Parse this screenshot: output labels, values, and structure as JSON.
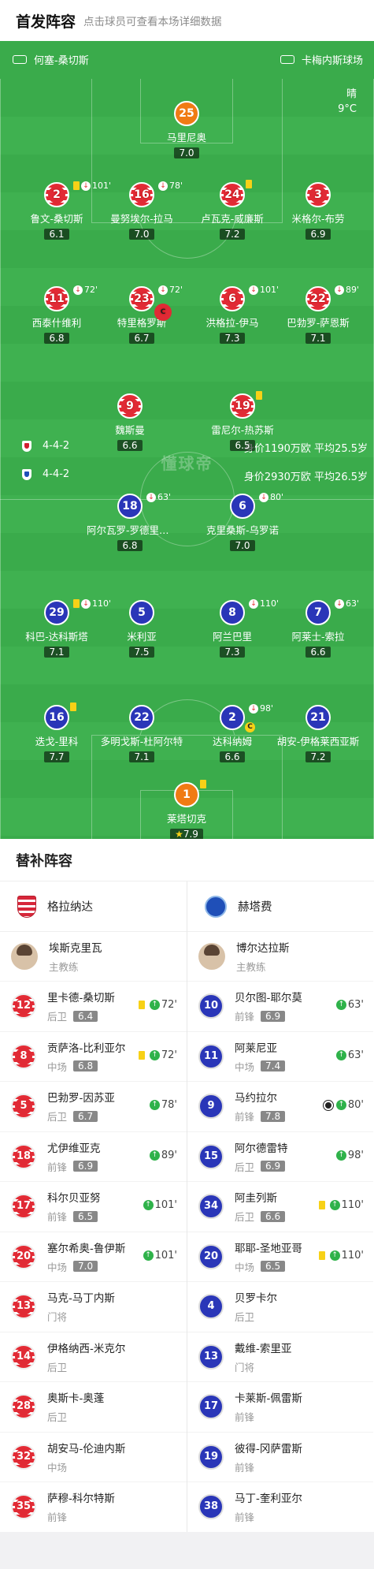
{
  "header": {
    "title": "首发阵容",
    "subtitle": "点击球员可查看本场详细数据"
  },
  "pitch": {
    "home_coach_label": "何塞-桑切斯",
    "venue": "卡梅内斯球场",
    "weather": "晴",
    "temp": "9°C",
    "watermark": "懂球帝",
    "home_formation": "4-4-2",
    "home_value": "身价1190万欧 平均25.5岁",
    "away_formation": "4-4-2",
    "away_value": "身价2930万欧 平均26.5岁"
  },
  "home_players": [
    {
      "num": "25",
      "name": "马里尼奥",
      "rating": "7.0",
      "kit": "orange"
    },
    {
      "num": "2",
      "name": "鲁文-桑切斯",
      "rating": "6.1",
      "kit": "red",
      "yellow": true,
      "sub": "101'"
    },
    {
      "num": "16",
      "name": "曼努埃尔-拉马",
      "rating": "7.0",
      "kit": "red",
      "sub": "78'"
    },
    {
      "num": "24",
      "name": "卢瓦克-威廉斯",
      "rating": "7.2",
      "kit": "red",
      "yellow": true
    },
    {
      "num": "3",
      "name": "米格尔-布劳",
      "rating": "6.9",
      "kit": "red"
    },
    {
      "num": "11",
      "name": "西泰什维利",
      "rating": "6.8",
      "kit": "red",
      "sub": "72'"
    },
    {
      "num": "23",
      "name": "特里格罗斯",
      "rating": "6.7",
      "kit": "red",
      "sub": "72'",
      "captain": "C"
    },
    {
      "num": "6",
      "name": "洪格拉-伊马",
      "rating": "7.3",
      "kit": "red",
      "sub": "101'"
    },
    {
      "num": "22",
      "name": "巴勃罗-萨恩斯",
      "rating": "7.1",
      "kit": "red",
      "sub": "89'"
    },
    {
      "num": "9",
      "name": "魏斯曼",
      "rating": "6.6",
      "kit": "red"
    },
    {
      "num": "19",
      "name": "雷尼尔-热苏斯",
      "rating": "6.5",
      "kit": "red",
      "yellow": true
    }
  ],
  "away_players": [
    {
      "num": "18",
      "name": "阿尔瓦罗-罗德里格斯",
      "rating": "6.8",
      "kit": "blue",
      "sub": "63'"
    },
    {
      "num": "6",
      "name": "克里桑斯-乌罗诺",
      "rating": "7.0",
      "kit": "blue",
      "sub": "80'"
    },
    {
      "num": "29",
      "name": "科巴-达科斯塔",
      "rating": "7.1",
      "kit": "blue",
      "yellow": true,
      "sub": "110'"
    },
    {
      "num": "5",
      "name": "米利亚",
      "rating": "7.5",
      "kit": "blue"
    },
    {
      "num": "8",
      "name": "阿兰巴里",
      "rating": "7.3",
      "kit": "blue",
      "sub": "110'"
    },
    {
      "num": "7",
      "name": "阿莱士-索拉",
      "rating": "6.6",
      "kit": "blue",
      "sub": "63'"
    },
    {
      "num": "16",
      "name": "迭戈-里科",
      "rating": "7.7",
      "kit": "blue",
      "yellow": true
    },
    {
      "num": "22",
      "name": "多明戈斯-杜阿尔特",
      "rating": "7.1",
      "kit": "blue"
    },
    {
      "num": "2",
      "name": "达科纳姆",
      "rating": "6.6",
      "kit": "blue",
      "sub": "98'",
      "captain": "C"
    },
    {
      "num": "21",
      "name": "胡安-伊格莱西亚斯",
      "rating": "7.2",
      "kit": "blue"
    },
    {
      "num": "1",
      "name": "莱塔切克",
      "rating": "7.9",
      "kit": "orange",
      "yellow": true,
      "star": true
    }
  ],
  "bench": {
    "title": "替补阵容",
    "home_team": "格拉纳达",
    "away_team": "赫塔费",
    "home_coach": {
      "name": "埃斯克里瓦",
      "role": "主教练"
    },
    "away_coach": {
      "name": "博尔达拉斯",
      "role": "主教练"
    },
    "home_subs": [
      {
        "num": "12",
        "name": "里卡德-桑切斯",
        "pos": "后卫",
        "rating": "6.4",
        "yellow": true,
        "in": "72'"
      },
      {
        "num": "8",
        "name": "贡萨洛-比利亚尔",
        "pos": "中场",
        "rating": "6.8",
        "yellow": true,
        "in": "72'"
      },
      {
        "num": "5",
        "name": "巴勃罗-因苏亚",
        "pos": "后卫",
        "rating": "6.7",
        "in": "78'"
      },
      {
        "num": "18",
        "name": "尤伊维亚克",
        "pos": "前锋",
        "rating": "6.9",
        "in": "89'"
      },
      {
        "num": "17",
        "name": "科尔贝亚努",
        "pos": "前锋",
        "rating": "6.5",
        "in": "101'"
      },
      {
        "num": "20",
        "name": "塞尔希奥-鲁伊斯",
        "pos": "中场",
        "rating": "7.0",
        "in": "101'"
      },
      {
        "num": "13",
        "name": "马克-马丁内斯",
        "pos": "门将"
      },
      {
        "num": "14",
        "name": "伊格纳西-米克尔",
        "pos": "后卫"
      },
      {
        "num": "28",
        "name": "奥斯卡-奥蓬",
        "pos": "后卫"
      },
      {
        "num": "32",
        "name": "胡安马-伦迪内斯",
        "pos": "中场"
      },
      {
        "num": "35",
        "name": "萨穆-科尔特斯",
        "pos": "前锋"
      }
    ],
    "away_subs": [
      {
        "num": "10",
        "name": "贝尔图-耶尔莫",
        "pos": "前锋",
        "rating": "6.9",
        "in": "63'"
      },
      {
        "num": "11",
        "name": "阿莱尼亚",
        "pos": "中场",
        "rating": "7.4",
        "in": "63'"
      },
      {
        "num": "9",
        "name": "马约拉尔",
        "pos": "前锋",
        "rating": "7.8",
        "goal": true,
        "in": "80'"
      },
      {
        "num": "15",
        "name": "阿尔德雷特",
        "pos": "后卫",
        "rating": "6.9",
        "in": "98'"
      },
      {
        "num": "34",
        "name": "阿圭列斯",
        "pos": "后卫",
        "rating": "6.6",
        "yellow": true,
        "in": "110'"
      },
      {
        "num": "20",
        "name": "耶耶-圣地亚哥",
        "pos": "中场",
        "rating": "6.5",
        "yellow": true,
        "in": "110'"
      },
      {
        "num": "4",
        "name": "贝罗卡尔",
        "pos": "后卫"
      },
      {
        "num": "13",
        "name": "戴维-索里亚",
        "pos": "门将"
      },
      {
        "num": "17",
        "name": "卡莱斯-佩雷斯",
        "pos": "前锋"
      },
      {
        "num": "19",
        "name": "彼得-冈萨雷斯",
        "pos": "前锋"
      },
      {
        "num": "38",
        "name": "马丁-奎利亚尔",
        "pos": "前锋"
      }
    ]
  },
  "colors": {
    "pitch": "#3fb150",
    "home_kit": "#e42b35",
    "away_kit": "#2a36b8",
    "keeper": "#f07b14",
    "yellow_card": "#f7d117",
    "sub_in": "#2fb24a"
  },
  "icons": {
    "whistle": "whistle-icon",
    "stadium": "stadium-icon",
    "sub_out": "sub-out-icon",
    "sub_in": "sub-in-icon",
    "goal": "ball-icon"
  }
}
